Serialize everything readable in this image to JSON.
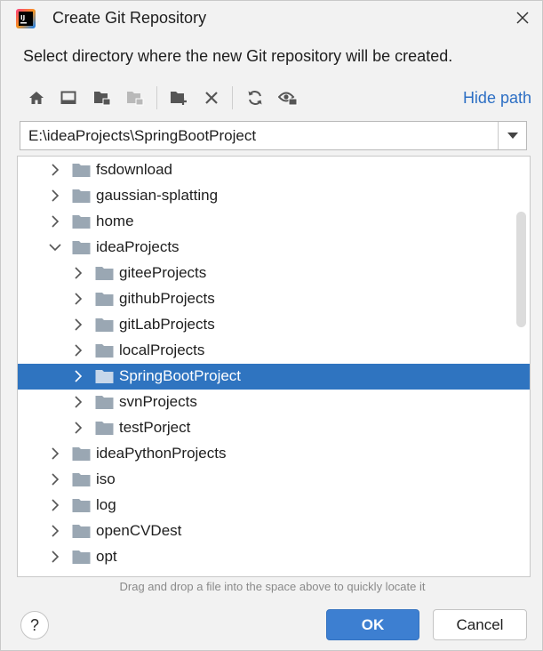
{
  "window": {
    "title": "Create Git Repository",
    "close_icon": "close-icon",
    "app_icon": "intellij-idea-icon"
  },
  "description": "Select directory where the new Git repository will be created.",
  "toolbar": {
    "buttons": [
      "home-icon",
      "desktop-icon",
      "project-folder-icon",
      "module-folder-icon",
      "new-folder-icon",
      "delete-icon",
      "refresh-icon",
      "show-hidden-icon"
    ],
    "hide_path_label": "Hide path"
  },
  "path": {
    "value": "E:\\ideaProjects\\SpringBootProject"
  },
  "tree": {
    "items": [
      {
        "label": "fsdownload",
        "level": 0,
        "expanded": false,
        "selected": false
      },
      {
        "label": "gaussian-splatting",
        "level": 0,
        "expanded": false,
        "selected": false
      },
      {
        "label": "home",
        "level": 0,
        "expanded": false,
        "selected": false
      },
      {
        "label": "ideaProjects",
        "level": 0,
        "expanded": true,
        "selected": false
      },
      {
        "label": "giteeProjects",
        "level": 1,
        "expanded": false,
        "selected": false
      },
      {
        "label": "githubProjects",
        "level": 1,
        "expanded": false,
        "selected": false
      },
      {
        "label": "gitLabProjects",
        "level": 1,
        "expanded": false,
        "selected": false
      },
      {
        "label": "localProjects",
        "level": 1,
        "expanded": false,
        "selected": false
      },
      {
        "label": "SpringBootProject",
        "level": 1,
        "expanded": false,
        "selected": true
      },
      {
        "label": "svnProjects",
        "level": 1,
        "expanded": false,
        "selected": false
      },
      {
        "label": "testPorject",
        "level": 1,
        "expanded": false,
        "selected": false
      },
      {
        "label": "ideaPythonProjects",
        "level": 0,
        "expanded": false,
        "selected": false
      },
      {
        "label": "iso",
        "level": 0,
        "expanded": false,
        "selected": false
      },
      {
        "label": "log",
        "level": 0,
        "expanded": false,
        "selected": false
      },
      {
        "label": "openCVDest",
        "level": 0,
        "expanded": false,
        "selected": false
      },
      {
        "label": "opt",
        "level": 0,
        "expanded": false,
        "selected": false
      }
    ]
  },
  "hint": "Drag and drop a file into the space above to quickly locate it",
  "footer": {
    "help_label": "?",
    "ok_label": "OK",
    "cancel_label": "Cancel"
  },
  "colors": {
    "accent": "#3d7fd1",
    "selection": "#2f74c0",
    "link": "#2d6fc4",
    "folder": "#9aa7b3"
  }
}
